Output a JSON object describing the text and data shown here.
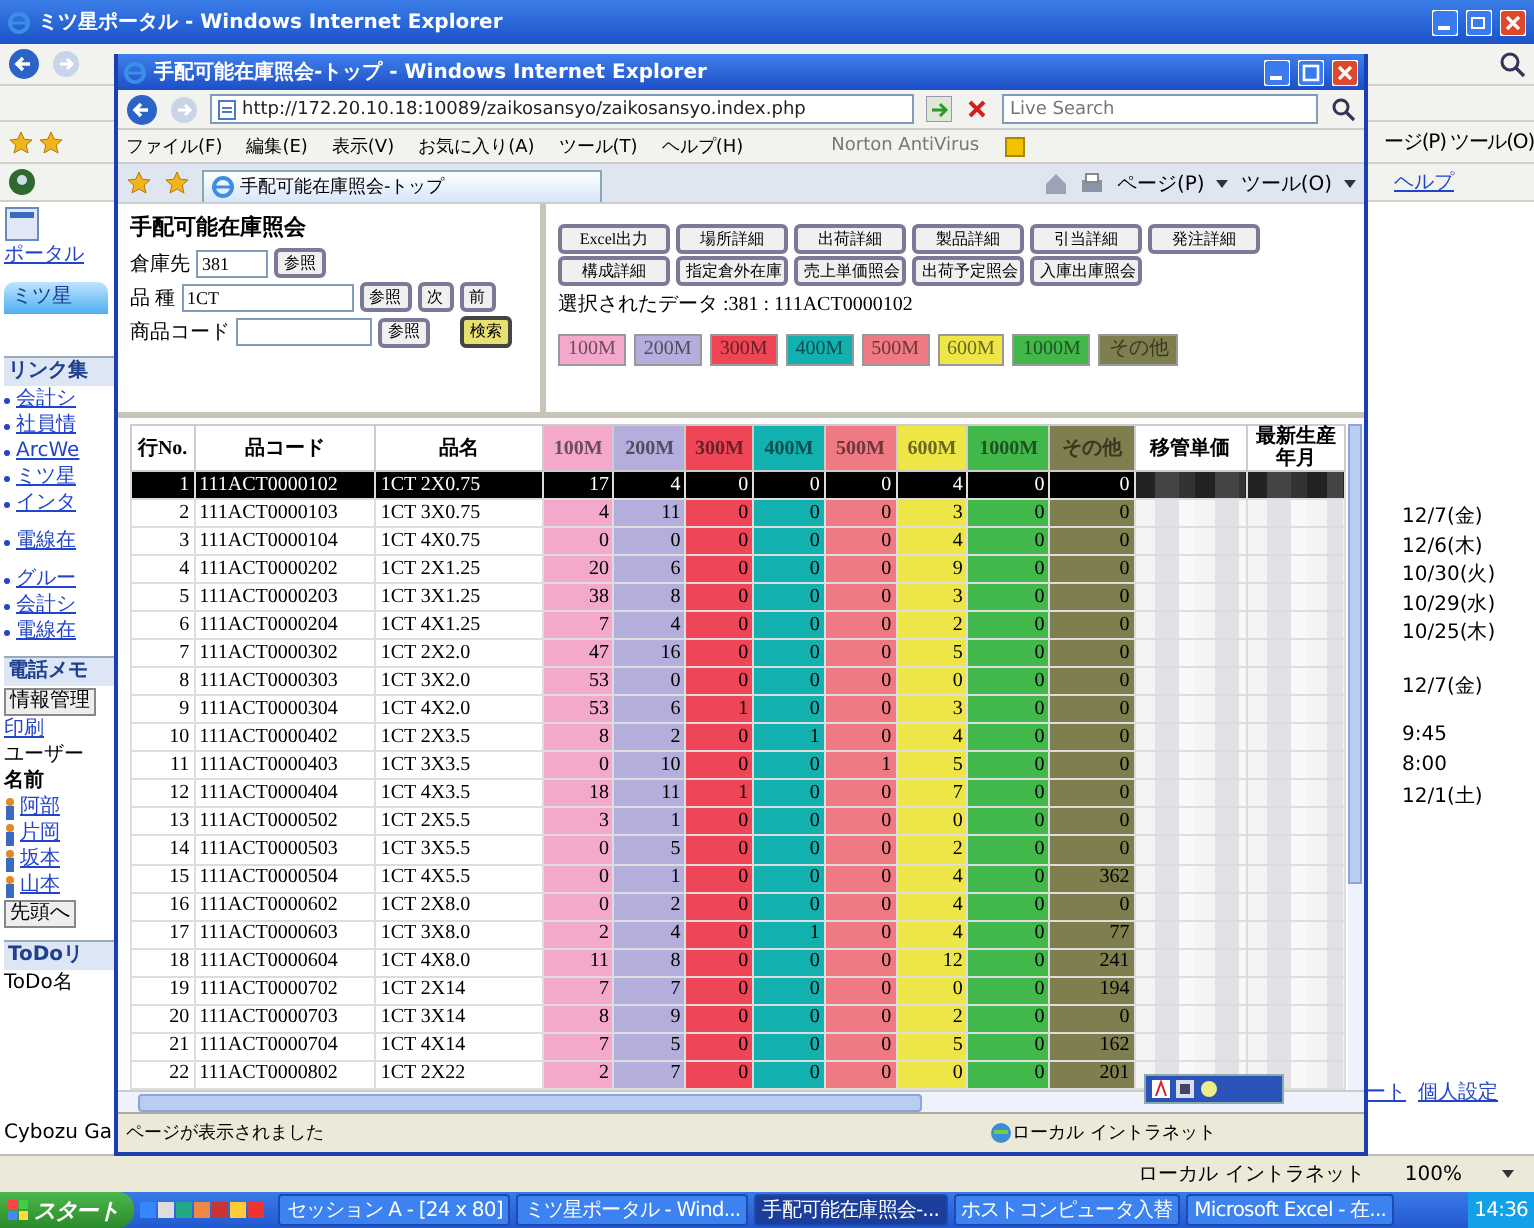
{
  "outer_window": {
    "title": "ミツ星ポータル - Windows Internet Explorer",
    "command_items": [
      "ージ(P)",
      "ツール(O)"
    ],
    "help_link": "ヘルプ",
    "sidebar": {
      "portal_label": "ポータル",
      "tab_label": "ミツ星",
      "links_title": "リンク集",
      "links": [
        {
          "label": "会計シ"
        },
        {
          "label": "社員情"
        },
        {
          "label": "ArcWe"
        },
        {
          "label": "ミツ星"
        },
        {
          "label": "インタ"
        },
        {
          "label": "電線在"
        },
        {
          "label": "グルー"
        },
        {
          "label": "会計シ"
        },
        {
          "label": "電線在"
        }
      ],
      "memo_title": "電話メモ",
      "memo_button": "情報管理",
      "print_link": "印刷",
      "users_title": "ユーザー",
      "users_column": "名前",
      "users": [
        {
          "name": "阿部"
        },
        {
          "name": "片岡"
        },
        {
          "name": "坂本"
        },
        {
          "name": "山本"
        }
      ],
      "first_button": "先頭へ",
      "todo_title": "ToDoリ",
      "todo_column": "ToDo名",
      "footer": "Cybozu Ga"
    },
    "schedule": [
      {
        "label": "12/7(金)"
      },
      {
        "label": "12/6(木)"
      },
      {
        "label": "10/30(火)"
      },
      {
        "label": "10/29(水)"
      },
      {
        "label": "10/25(木)"
      },
      {
        "label": "12/7(金)"
      },
      {
        "label": "9:45"
      },
      {
        "label": "8:00"
      },
      {
        "label": "12/1(土)"
      }
    ],
    "footer_links": [
      "ート",
      "個人設定"
    ],
    "status": {
      "zone": "ローカル イントラネット",
      "zoom": "100%"
    }
  },
  "inner_window": {
    "title": "手配可能在庫照会-トップ - Windows Internet Explorer",
    "address": "http://172.20.10.18:10089/zaikosansyo/zaikosansyo.index.php",
    "search": {
      "placeholder": "Live Search"
    },
    "menu": [
      "ファイル(F)",
      "編集(E)",
      "表示(V)",
      "お気に入り(A)",
      "ツール(T)",
      "ヘルプ(H)"
    ],
    "toolbar_label": "Norton AntiVirus",
    "tab_label": "手配可能在庫照会-トップ",
    "command_items": [
      "ページ(P)",
      "ツール(O)"
    ],
    "status": {
      "message": "ページが表示されました",
      "zone": "ローカル イントラネット"
    }
  },
  "form": {
    "title": "手配可能在庫照会",
    "fields": [
      {
        "label": "倉庫先",
        "value": "381",
        "buttons": [
          "参照"
        ]
      },
      {
        "label": "品 種",
        "value": "1CT",
        "buttons": [
          "参照",
          "次",
          "前"
        ]
      },
      {
        "label": "商品コード",
        "buttons": [
          "参照"
        ]
      }
    ],
    "search_button": "検索"
  },
  "actions": [
    [
      "Excel出力",
      "場所詳細",
      "出荷詳細",
      "製品詳細",
      "引当詳細",
      "発注詳細"
    ],
    [
      "構成詳細",
      "指定倉外在庫",
      "売上単価照会",
      "出荷予定照会",
      "入庫出庫照会"
    ]
  ],
  "selected_data": "選択されたデータ :381 : 111ACT0000102",
  "legend": [
    {
      "label": "100M",
      "color": "#f4a8cc"
    },
    {
      "label": "200M",
      "color": "#b4aedc"
    },
    {
      "label": "300M",
      "color": "#ee4656"
    },
    {
      "label": "400M",
      "color": "#12b0ae"
    },
    {
      "label": "500M",
      "color": "#f07a84"
    },
    {
      "label": "600M",
      "color": "#eee646"
    },
    {
      "label": "1000M",
      "color": "#42b84a"
    },
    {
      "label": "その他",
      "color": "#7e7e4e"
    }
  ],
  "table": {
    "columns": [
      {
        "label": "行No."
      },
      {
        "label": "品コード"
      },
      {
        "label": "品名"
      },
      {
        "label": "100M",
        "color": "#f4a8cc"
      },
      {
        "label": "200M",
        "color": "#b4aedc"
      },
      {
        "label": "300M",
        "color": "#ee4656"
      },
      {
        "label": "400M",
        "color": "#12b0ae"
      },
      {
        "label": "500M",
        "color": "#f07a84"
      },
      {
        "label": "600M",
        "color": "#eee646"
      },
      {
        "label": "1000M",
        "color": "#42b84a"
      },
      {
        "label": "その他",
        "color": "#7e7e4e"
      },
      {
        "label": "移管単価"
      },
      {
        "label": "最新生産年月"
      }
    ],
    "rows": [
      {
        "no": "1",
        "code": "111ACT0000102",
        "name": "1CT 2X0.75",
        "values": [
          "17",
          "4",
          "0",
          "0",
          "0",
          "4",
          "0",
          "0"
        ],
        "selected": true
      },
      {
        "no": "2",
        "code": "111ACT0000103",
        "name": "1CT 3X0.75",
        "values": [
          "4",
          "11",
          "0",
          "0",
          "0",
          "3",
          "0",
          "0"
        ],
        "selected": false
      },
      {
        "no": "3",
        "code": "111ACT0000104",
        "name": "1CT 4X0.75",
        "values": [
          "0",
          "0",
          "0",
          "0",
          "0",
          "4",
          "0",
          "0"
        ],
        "selected": false
      },
      {
        "no": "4",
        "code": "111ACT0000202",
        "name": "1CT 2X1.25",
        "values": [
          "20",
          "6",
          "0",
          "0",
          "0",
          "9",
          "0",
          "0"
        ],
        "selected": false
      },
      {
        "no": "5",
        "code": "111ACT0000203",
        "name": "1CT 3X1.25",
        "values": [
          "38",
          "8",
          "0",
          "0",
          "0",
          "3",
          "0",
          "0"
        ],
        "selected": false
      },
      {
        "no": "6",
        "code": "111ACT0000204",
        "name": "1CT 4X1.25",
        "values": [
          "7",
          "4",
          "0",
          "0",
          "0",
          "2",
          "0",
          "0"
        ],
        "selected": false
      },
      {
        "no": "7",
        "code": "111ACT0000302",
        "name": "1CT 2X2.0",
        "values": [
          "47",
          "16",
          "0",
          "0",
          "0",
          "5",
          "0",
          "0"
        ],
        "selected": false
      },
      {
        "no": "8",
        "code": "111ACT0000303",
        "name": "1CT 3X2.0",
        "values": [
          "53",
          "0",
          "0",
          "0",
          "0",
          "0",
          "0",
          "0"
        ],
        "selected": false
      },
      {
        "no": "9",
        "code": "111ACT0000304",
        "name": "1CT 4X2.0",
        "values": [
          "53",
          "6",
          "1",
          "0",
          "0",
          "3",
          "0",
          "0"
        ],
        "selected": false
      },
      {
        "no": "10",
        "code": "111ACT0000402",
        "name": "1CT 2X3.5",
        "values": [
          "8",
          "2",
          "0",
          "1",
          "0",
          "4",
          "0",
          "0"
        ],
        "selected": false
      },
      {
        "no": "11",
        "code": "111ACT0000403",
        "name": "1CT 3X3.5",
        "values": [
          "0",
          "10",
          "0",
          "0",
          "1",
          "5",
          "0",
          "0"
        ],
        "selected": false
      },
      {
        "no": "12",
        "code": "111ACT0000404",
        "name": "1CT 4X3.5",
        "values": [
          "18",
          "11",
          "1",
          "0",
          "0",
          "7",
          "0",
          "0"
        ],
        "selected": false
      },
      {
        "no": "13",
        "code": "111ACT0000502",
        "name": "1CT 2X5.5",
        "values": [
          "3",
          "1",
          "0",
          "0",
          "0",
          "0",
          "0",
          "0"
        ],
        "selected": false
      },
      {
        "no": "14",
        "code": "111ACT0000503",
        "name": "1CT 3X5.5",
        "values": [
          "0",
          "5",
          "0",
          "0",
          "0",
          "2",
          "0",
          "0"
        ],
        "selected": false
      },
      {
        "no": "15",
        "code": "111ACT0000504",
        "name": "1CT 4X5.5",
        "values": [
          "0",
          "1",
          "0",
          "0",
          "0",
          "4",
          "0",
          "362"
        ],
        "selected": false
      },
      {
        "no": "16",
        "code": "111ACT0000602",
        "name": "1CT 2X8.0",
        "values": [
          "0",
          "2",
          "0",
          "0",
          "0",
          "4",
          "0",
          "0"
        ],
        "selected": false
      },
      {
        "no": "17",
        "code": "111ACT0000603",
        "name": "1CT 3X8.0",
        "values": [
          "2",
          "4",
          "0",
          "1",
          "0",
          "4",
          "0",
          "77"
        ],
        "selected": false
      },
      {
        "no": "18",
        "code": "111ACT0000604",
        "name": "1CT 4X8.0",
        "values": [
          "11",
          "8",
          "0",
          "0",
          "0",
          "12",
          "0",
          "241"
        ],
        "selected": false
      },
      {
        "no": "19",
        "code": "111ACT0000702",
        "name": "1CT 2X14",
        "values": [
          "7",
          "7",
          "0",
          "0",
          "0",
          "0",
          "0",
          "194"
        ],
        "selected": false
      },
      {
        "no": "20",
        "code": "111ACT0000703",
        "name": "1CT 3X14",
        "values": [
          "8",
          "9",
          "0",
          "0",
          "0",
          "2",
          "0",
          "0"
        ],
        "selected": false
      },
      {
        "no": "21",
        "code": "111ACT0000704",
        "name": "1CT 4X14",
        "values": [
          "7",
          "5",
          "0",
          "0",
          "0",
          "5",
          "0",
          "162"
        ],
        "selected": false
      },
      {
        "no": "22",
        "code": "111ACT0000802",
        "name": "1CT 2X22",
        "values": [
          "2",
          "7",
          "0",
          "0",
          "0",
          "0",
          "0",
          "201"
        ],
        "selected": false
      }
    ]
  },
  "taskbar": {
    "start": "スタート",
    "tasks": [
      {
        "label": "セッション A - [24 x 80]",
        "selected": false
      },
      {
        "label": "ミツ星ポータル - Wind...",
        "selected": false
      },
      {
        "label": "手配可能在庫照会-...",
        "selected": true
      },
      {
        "label": "ホストコンピュータ入替",
        "selected": false
      },
      {
        "label": "Microsoft Excel - 在...",
        "selected": false
      }
    ],
    "clock": "14:36"
  }
}
